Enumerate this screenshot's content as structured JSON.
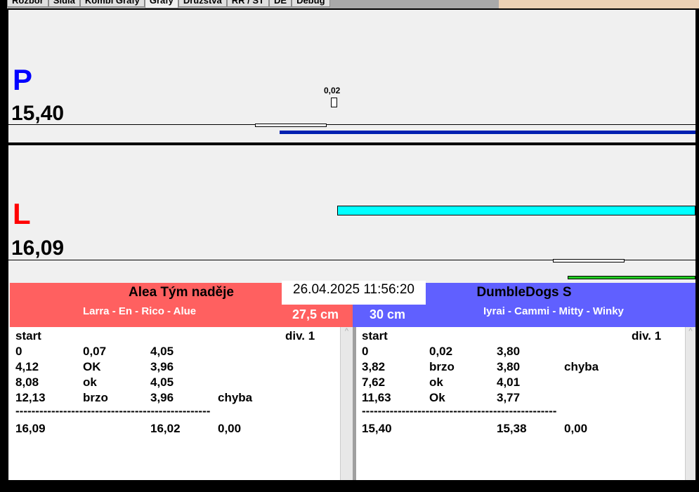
{
  "tabs": [
    "Rozbor",
    "Sidla",
    "Kombi Grafy",
    "Grafy",
    "Družstva",
    "RR / ST",
    "DE",
    "Debug"
  ],
  "active_tab": "Grafy",
  "lane_p": {
    "letter": "P",
    "time": "15,40",
    "marker": "0,02",
    "color": "#0000ff",
    "bar_color": "#0020b0"
  },
  "lane_l": {
    "letter": "L",
    "time": "16,09",
    "color": "#ff0000",
    "bar_color": "#00ffff",
    "bar2_color": "#22cc22"
  },
  "datetime": "26.04.2025 11:56:20",
  "left_team": {
    "name": "Alea Tým naděje",
    "dogs": "Larra - En - Rico - Alue",
    "height": "27,5 cm",
    "color": "#ff6060",
    "header": [
      "start",
      "div.  1"
    ],
    "rows": [
      [
        "0",
        "0,07",
        "4,05",
        ""
      ],
      [
        "4,12",
        "OK",
        "3,96",
        ""
      ],
      [
        "8,08",
        "ok",
        "4,05",
        ""
      ],
      [
        "12,13",
        "brzo",
        "3,96",
        "chyba"
      ]
    ],
    "separator": "-------------------------------------------------",
    "total": [
      "16,09",
      "",
      "16,02",
      "0,00"
    ]
  },
  "right_team": {
    "name": "DumbleDogs S",
    "dogs": "Iyrai - Cammi - Mitty - Winky",
    "height": "30 cm",
    "color": "#6060ff",
    "header": [
      "start",
      "div.  1"
    ],
    "rows": [
      [
        "0",
        "0,02",
        "3,80",
        ""
      ],
      [
        "3,82",
        "brzo",
        "3,80",
        "chyba"
      ],
      [
        "7,62",
        "ok",
        "4,01",
        ""
      ],
      [
        "11,63",
        "Ok",
        "3,77",
        ""
      ]
    ],
    "separator": "-------------------------------------------------",
    "total": [
      "15,40",
      "",
      "15,38",
      "0,00"
    ]
  }
}
